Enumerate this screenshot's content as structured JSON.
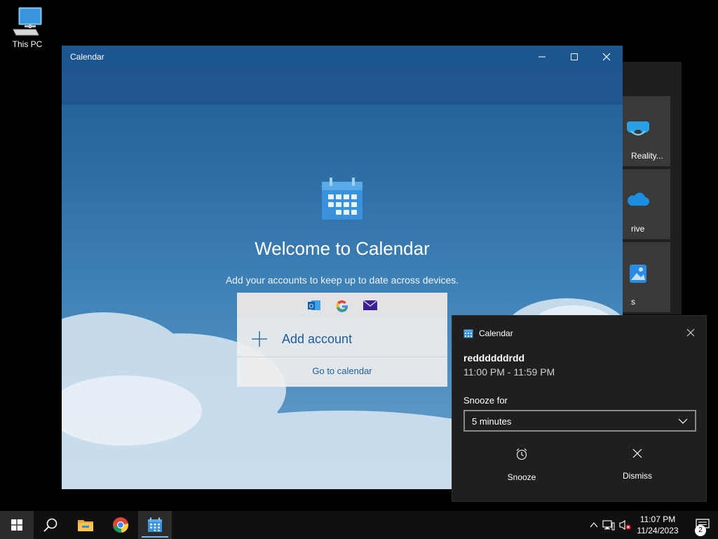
{
  "desktop": {
    "icons": [
      {
        "label": "This PC"
      }
    ]
  },
  "start_tiles": [
    {
      "label": "Reality..."
    },
    {
      "label": "rive"
    },
    {
      "label": "s"
    }
  ],
  "window": {
    "title": "Calendar",
    "welcome_title": "Welcome to Calendar",
    "welcome_subtitle": "Add your accounts to keep up to date across devices.",
    "add_account_label": "Add account",
    "go_to_calendar_label": "Go to calendar",
    "account_providers": [
      "outlook-icon",
      "google-icon",
      "mail-icon"
    ]
  },
  "notification": {
    "app_name": "Calendar",
    "event_title": "reddddddrdd",
    "event_time": "11:00 PM - 11:59 PM",
    "snooze_label": "Snooze for",
    "snooze_selected": "5 minutes",
    "snooze_button": "Snooze",
    "dismiss_button": "Dismiss"
  },
  "taskbar": {
    "time": "11:07 PM",
    "date": "11/24/2023",
    "notification_count": "2",
    "pinned": [
      "windows-start-icon",
      "search-icon",
      "file-explorer-icon",
      "chrome-icon",
      "calendar-icon"
    ]
  },
  "colors": {
    "accent": "#1d5590",
    "link": "#1e5b9c",
    "toast_bg": "#1f1f1f",
    "taskbar_bg": "#101010"
  }
}
